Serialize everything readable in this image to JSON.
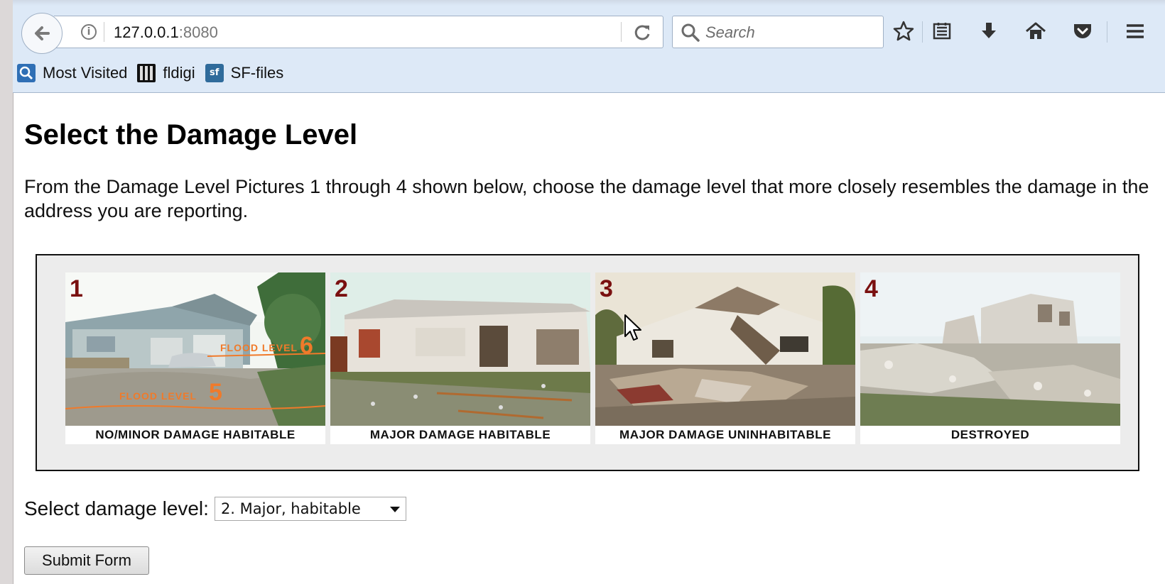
{
  "browser": {
    "url_host": "127.0.0.1",
    "url_port": ":8080",
    "search_placeholder": "Search",
    "bookmarks": [
      {
        "label": "Most Visited",
        "icon": "most-visited-icon"
      },
      {
        "label": "fldigi",
        "icon": "fldigi-icon"
      },
      {
        "label": "SF-files",
        "icon": "sf-icon"
      }
    ],
    "sf_icon_text": "sf",
    "info_icon_glyph": "i"
  },
  "page": {
    "title": "Select the Damage Level",
    "intro": "From the Damage Level Pictures 1 through 4 shown below, choose the damage level that more closely resembles the damage in the address you are reporting."
  },
  "gallery": {
    "panels": [
      {
        "number": "1",
        "caption": "NO/MINOR DAMAGE HABITABLE",
        "flood_label_a": "FLOOD LEVEL",
        "flood_num_a": "6",
        "flood_label_b": "FLOOD LEVEL",
        "flood_num_b": "5"
      },
      {
        "number": "2",
        "caption": "MAJOR DAMAGE HABITABLE"
      },
      {
        "number": "3",
        "caption": "MAJOR DAMAGE UNINHABITABLE"
      },
      {
        "number": "4",
        "caption": "DESTROYED"
      }
    ]
  },
  "form": {
    "select_label": "Select damage level:",
    "select_value": "2. Major, habitable",
    "submit_label": "Submit Form"
  },
  "colors": {
    "chrome_bg": "#dde9f7",
    "number_color": "#7a1010",
    "flood_color": "#f07a2a"
  }
}
